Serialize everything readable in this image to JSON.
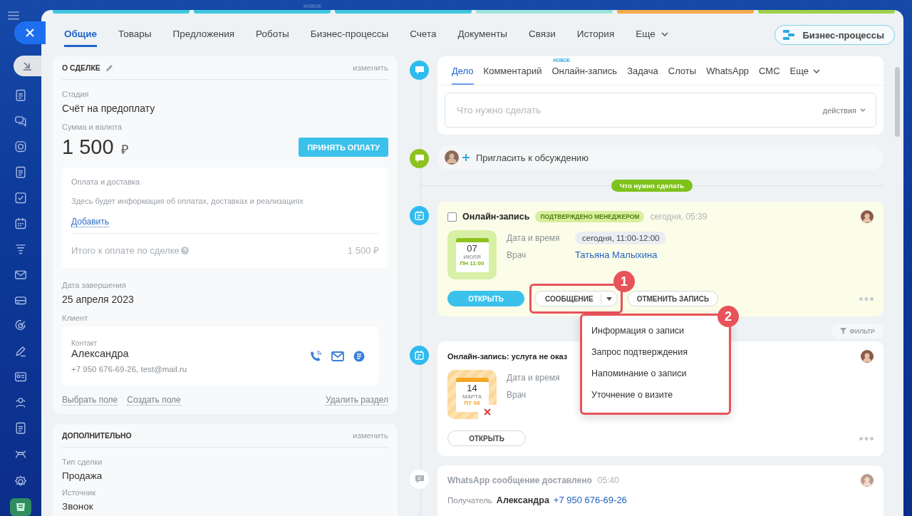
{
  "header": {
    "new_label": "НОВОЕ",
    "stages": [
      {
        "color": "#3ec7e2"
      },
      {
        "color": "#3ec7e2"
      },
      {
        "color": "#3ec7e2"
      },
      {
        "color": "#9ee3dc"
      },
      {
        "color": "#f5a94a"
      },
      {
        "color": "#9fd14b"
      }
    ]
  },
  "tabs": [
    {
      "label": "Общие",
      "selected": true,
      "kind": "tab"
    },
    {
      "label": "Товары",
      "selected": false,
      "kind": "tab"
    },
    {
      "label": "Предложения",
      "selected": false,
      "kind": "tab"
    },
    {
      "label": "Роботы",
      "selected": false,
      "kind": "tab"
    },
    {
      "label": "Бизнес-процессы",
      "selected": false,
      "kind": "tab"
    },
    {
      "label": "Счета",
      "selected": false,
      "kind": "tab"
    },
    {
      "label": "Документы",
      "selected": false,
      "kind": "tab"
    },
    {
      "label": "Связи",
      "selected": false,
      "kind": "tab"
    },
    {
      "label": "История",
      "selected": false,
      "kind": "tab"
    },
    {
      "label": "Еще",
      "selected": false,
      "kind": "more"
    }
  ],
  "process_button": "Бизнес-процессы",
  "deal": {
    "title": "О СДЕЛКЕ",
    "edit": "изменить",
    "stage_label": "Стадия",
    "stage": "Счёт на предоплату",
    "amount_label": "Сумма и валюта",
    "amount": "1 500",
    "currency": "₽",
    "pay_button": "ПРИНЯТЬ ОПЛАТУ",
    "payment": {
      "title": "Оплата и доставка",
      "text": "Здесь будет информация об оплатах, доставках и реализациях",
      "add": "Добавить",
      "total_label": "Итого к оплате по сделке",
      "total": "1 500 ₽"
    },
    "close_label": "Дата завершения",
    "close_date": "25 апреля 2023",
    "client_label": "Клиент",
    "contact": {
      "label": "Контакт",
      "name": "Александра",
      "details": "+7 950 676-69-26, test@mail.ru"
    },
    "links": [
      "Выбрать поле",
      "Создать поле"
    ],
    "delete": "Удалить раздел"
  },
  "extra": {
    "title": "ДОПОЛНИТЕЛЬНО",
    "edit": "изменить",
    "fields": [
      {
        "label": "Тип сделки",
        "value": "Продажа"
      },
      {
        "label": "Источник",
        "value": "Звонок"
      }
    ]
  },
  "composer": {
    "tabs": [
      {
        "label": "Дело",
        "selected": true,
        "kind": "tab"
      },
      {
        "label": "Комментарий",
        "selected": false,
        "kind": "tab"
      },
      {
        "label": "Онлайн-запись",
        "selected": false,
        "kind": "tab",
        "badge": "НОВОЕ"
      },
      {
        "label": "Задача",
        "selected": false,
        "kind": "tab"
      },
      {
        "label": "Слоты",
        "selected": false,
        "kind": "tab"
      },
      {
        "label": "WhatsApp",
        "selected": false,
        "kind": "tab"
      },
      {
        "label": "СМС",
        "selected": false,
        "kind": "tab"
      },
      {
        "label": "Еще",
        "selected": false,
        "kind": "more"
      }
    ],
    "placeholder": "Что нужно сделать",
    "actions": "действия"
  },
  "invite": "Пригласить к обсуждению",
  "divider_label": "Что нужно сделать",
  "booking": {
    "done": false,
    "title": "Онлайн-запись",
    "status": "ПОДТВЕРЖДЕНО МЕНЕДЖЕРОМ",
    "time": "сегодня, 05:39",
    "calendar": {
      "kind": "confirmed",
      "day": "07",
      "month": "ИЮЛЯ",
      "weekday": "ПН 11:00"
    },
    "fields": [
      {
        "label": "Дата и время",
        "value": "сегодня, 11:00-12:00",
        "kind": "pill"
      },
      {
        "label": "Врач",
        "value": "Татьяна Малыхина",
        "kind": "link"
      }
    ],
    "open": "ОТКРЫТЬ",
    "message": "СООБЩЕНИЕ",
    "cancel": "ОТМЕНИТЬ ЗАПИСЬ"
  },
  "filter": "ФИЛЬТР",
  "booking2": {
    "title": "Онлайн-запись: услуга не оказ",
    "calendar": {
      "kind": "cancelled",
      "day": "14",
      "month": "МАРТА",
      "weekday": "ПТ 08"
    },
    "fields": [
      {
        "label": "Дата и время"
      },
      {
        "label": "Врач"
      }
    ],
    "open": "ОТКРЫТЬ"
  },
  "whatsapp": {
    "title": "WhatsApp сообщение доставлено",
    "time": "05:40",
    "recipient_label": "Получатель",
    "recipient": "Александра",
    "phone": "+7 950 676-69-26"
  },
  "message_menu": {
    "items": [
      "Информация о записи",
      "Запрос подтверждения",
      "Напоминание о записи",
      "Уточнение о визите"
    ]
  },
  "callouts": [
    "1",
    "2"
  ]
}
